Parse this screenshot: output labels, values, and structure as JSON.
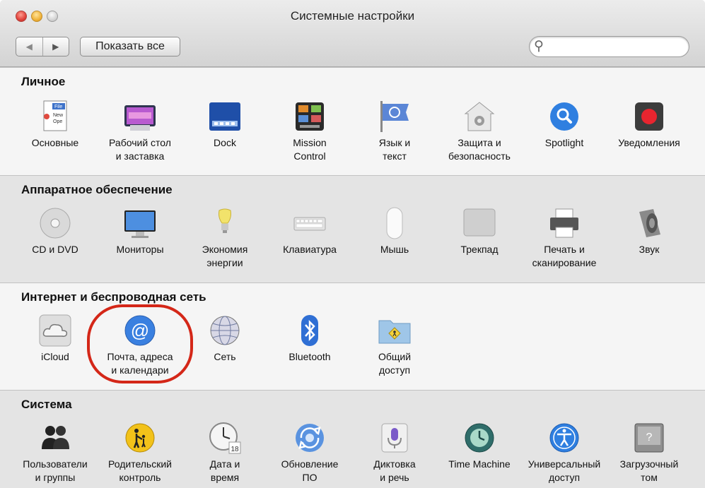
{
  "window": {
    "title": "Системные настройки"
  },
  "toolbar": {
    "back_label": "◀",
    "forward_label": "▶",
    "show_all_label": "Показать все",
    "search_placeholder": ""
  },
  "sections": [
    {
      "title": "Личное",
      "items": [
        {
          "label": "Основные",
          "icon": "general-icon"
        },
        {
          "label": "Рабочий стол\nи заставка",
          "icon": "desktop-icon"
        },
        {
          "label": "Dock",
          "icon": "dock-icon"
        },
        {
          "label": "Mission\nControl",
          "icon": "mission-control-icon"
        },
        {
          "label": "Язык и\nтекст",
          "icon": "language-icon"
        },
        {
          "label": "Защита и\nбезопасность",
          "icon": "security-icon"
        },
        {
          "label": "Spotlight",
          "icon": "spotlight-icon"
        },
        {
          "label": "Уведомления",
          "icon": "notifications-icon"
        }
      ]
    },
    {
      "title": "Аппаратное обеспечение",
      "items": [
        {
          "label": "CD и DVD",
          "icon": "cd-dvd-icon"
        },
        {
          "label": "Мониторы",
          "icon": "monitor-icon"
        },
        {
          "label": "Экономия\nэнергии",
          "icon": "energy-icon"
        },
        {
          "label": "Клавиатура",
          "icon": "keyboard-icon"
        },
        {
          "label": "Мышь",
          "icon": "mouse-icon"
        },
        {
          "label": "Трекпад",
          "icon": "trackpad-icon"
        },
        {
          "label": "Печать и\nсканирование",
          "icon": "printer-icon"
        },
        {
          "label": "Звук",
          "icon": "speaker-icon"
        }
      ]
    },
    {
      "title": "Интернет и беспроводная сеть",
      "items": [
        {
          "label": "iCloud",
          "icon": "icloud-icon"
        },
        {
          "label": "Почта, адреса\nи календари",
          "icon": "mail-at-icon"
        },
        {
          "label": "Сеть",
          "icon": "network-globe-icon"
        },
        {
          "label": "Bluetooth",
          "icon": "bluetooth-icon"
        },
        {
          "label": "Общий\nдоступ",
          "icon": "sharing-folder-icon"
        }
      ]
    },
    {
      "title": "Система",
      "items": [
        {
          "label": "Пользователи\nи группы",
          "icon": "users-icon"
        },
        {
          "label": "Родительский\nконтроль",
          "icon": "parental-icon"
        },
        {
          "label": "Дата и\nвремя",
          "icon": "clock-icon"
        },
        {
          "label": "Обновление\nПО",
          "icon": "software-update-icon"
        },
        {
          "label": "Диктовка\nи речь",
          "icon": "microphone-icon"
        },
        {
          "label": "Time Machine",
          "icon": "time-machine-icon"
        },
        {
          "label": "Универсальный\nдоступ",
          "icon": "accessibility-icon"
        },
        {
          "label": "Загрузочный\nтом",
          "icon": "startup-disk-icon"
        }
      ]
    }
  ],
  "highlight": {
    "color": "#d42718",
    "target": "Почта, адреса и календари"
  }
}
